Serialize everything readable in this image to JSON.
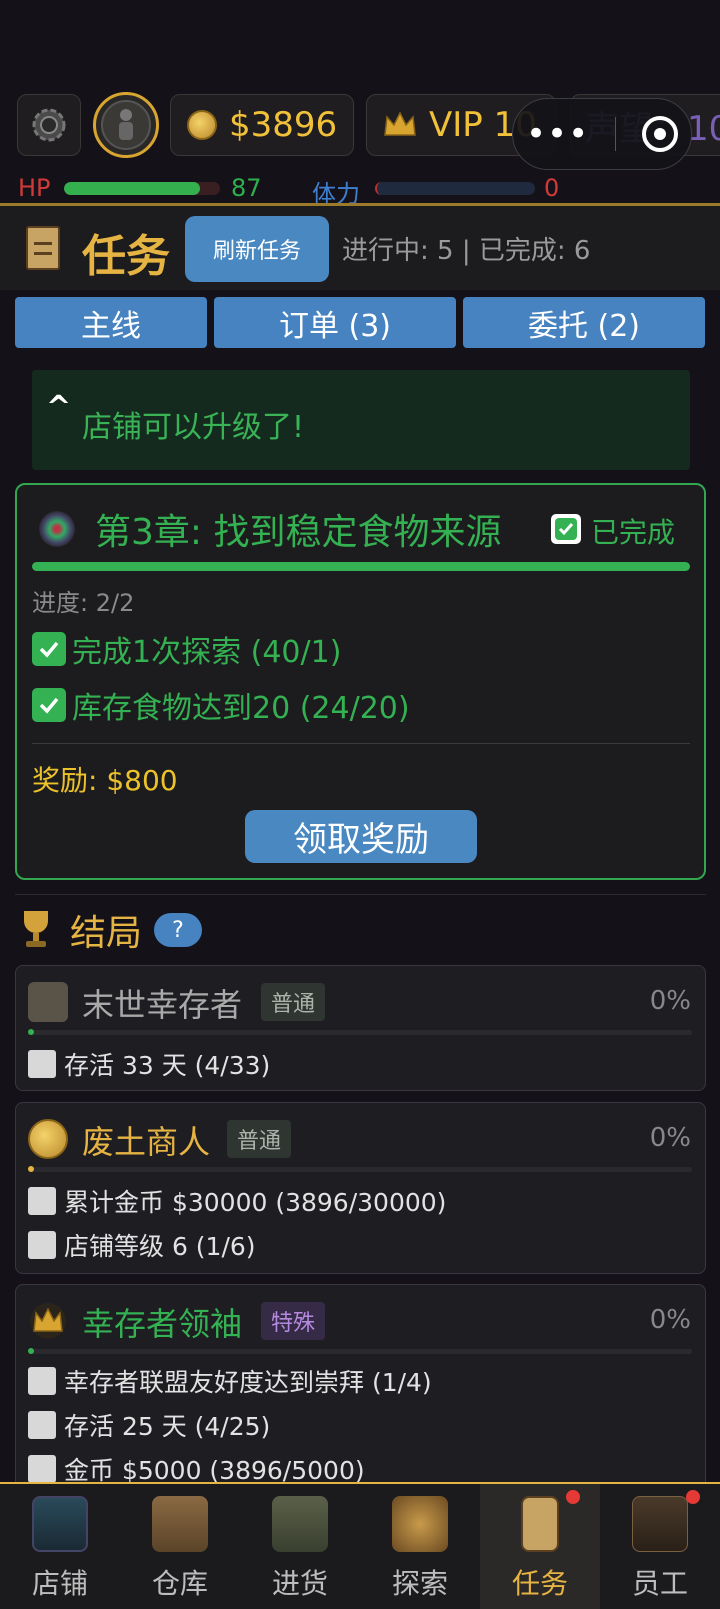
{
  "topbar": {
    "money": "$3896",
    "vip": "VIP 10",
    "reputation": "声望：10"
  },
  "stats": {
    "hp_label": "HP",
    "hp_value": "87",
    "hp_fraction": 0.87,
    "stamina_label": "体力",
    "stamina_value": "0",
    "stamina_fraction": 0
  },
  "header": {
    "title": "任务",
    "refresh_label": "刷新任务",
    "progress_summary": "进行中: 5 | 已完成: 6"
  },
  "tabs": [
    {
      "label": "主线"
    },
    {
      "label": "订单 (3)"
    },
    {
      "label": "委托 (2)"
    }
  ],
  "notice": {
    "caret": "^",
    "text": "店铺可以升级了!"
  },
  "chapter": {
    "title": "第3章: 找到稳定食物来源",
    "status": "已完成",
    "progress": "进度: 2/2",
    "progress_fraction": 1.0,
    "objectives": [
      {
        "text": "完成1次探索 (40/1)"
      },
      {
        "text": "库存食物达到20 (24/20)"
      }
    ],
    "reward": "奖励: $800",
    "claim_label": "领取奖励"
  },
  "endings": {
    "title": "结局",
    "help": "?",
    "items": [
      {
        "title": "末世幸存者",
        "badge": "普通",
        "percent": "0%",
        "title_color": "#a9a9a9",
        "requirements": [
          {
            "text": "存活 33 天 (4/33)"
          }
        ]
      },
      {
        "title": "废土商人",
        "badge": "普通",
        "percent": "0%",
        "title_color": "#e6b443",
        "requirements": [
          {
            "text": "累计金币 $30000 (3896/30000)"
          },
          {
            "text": "店铺等级 6 (1/6)"
          }
        ]
      },
      {
        "title": "幸存者领袖",
        "badge": "特殊",
        "percent": "0%",
        "title_color": "#34b152",
        "requirements": [
          {
            "text": "幸存者联盟友好度达到崇拜 (1/4)"
          },
          {
            "text": "存活 25 天 (4/25)"
          },
          {
            "text": "金币 $5000 (3896/5000)"
          }
        ]
      }
    ]
  },
  "nav": [
    {
      "label": "店铺",
      "icon": "shop-icon"
    },
    {
      "label": "仓库",
      "icon": "warehouse-icon"
    },
    {
      "label": "进货",
      "icon": "truck-icon"
    },
    {
      "label": "探索",
      "icon": "map-icon"
    },
    {
      "label": "任务",
      "icon": "quest-icon",
      "active": true,
      "badge": true
    },
    {
      "label": "员工",
      "icon": "staff-icon",
      "badge": true
    }
  ]
}
